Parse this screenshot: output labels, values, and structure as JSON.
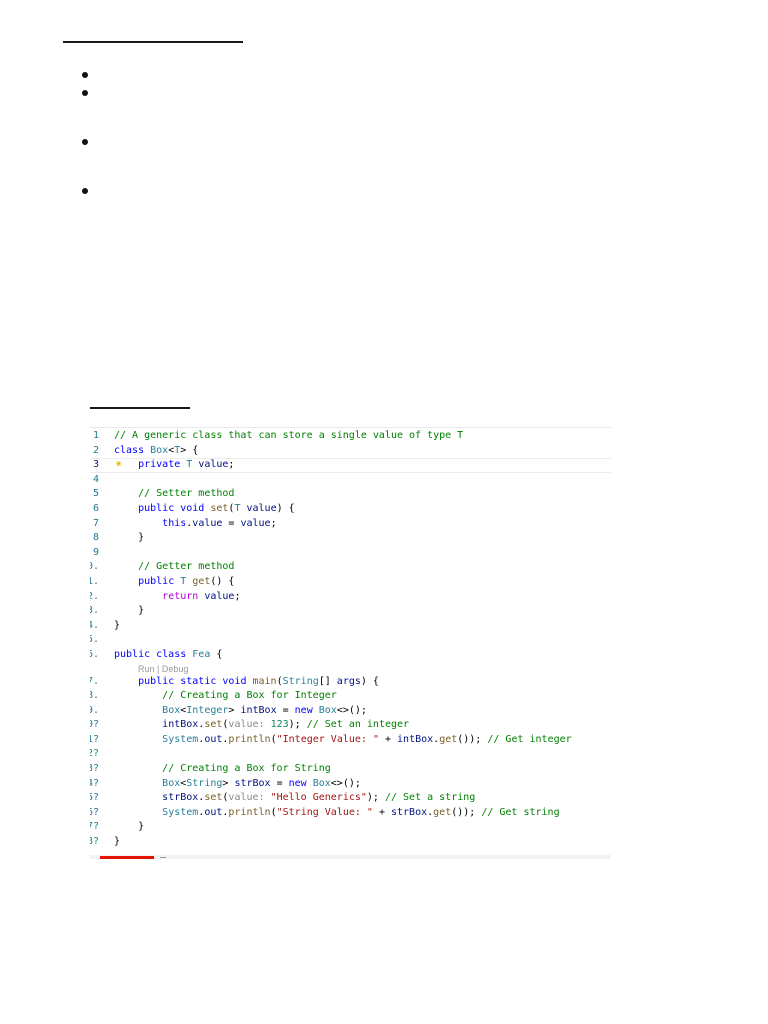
{
  "bullets": [
    "",
    "",
    "",
    ""
  ],
  "editor": {
    "breadcrumb": "",
    "lines": [
      {
        "no": "1",
        "tokens": [
          {
            "c": "cm",
            "t": "// A generic class that can store a single value of type T"
          }
        ]
      },
      {
        "no": "2",
        "tokens": [
          {
            "c": "kw",
            "t": "class "
          },
          {
            "c": "ty",
            "t": "Box"
          },
          {
            "c": "pl",
            "t": "<"
          },
          {
            "c": "ty",
            "t": "T"
          },
          {
            "c": "pl",
            "t": "> {"
          }
        ]
      },
      {
        "no": "3",
        "active": true,
        "bulb": true,
        "tokens": [
          {
            "c": "pl",
            "t": "    "
          },
          {
            "c": "kw",
            "t": "private "
          },
          {
            "c": "ty",
            "t": "T "
          },
          {
            "c": "vr",
            "t": "value"
          },
          {
            "c": "pl",
            "t": ";"
          }
        ]
      },
      {
        "no": "4",
        "tokens": []
      },
      {
        "no": "5",
        "tokens": [
          {
            "c": "pl",
            "t": "    "
          },
          {
            "c": "cm",
            "t": "// Setter method"
          }
        ]
      },
      {
        "no": "6",
        "tokens": [
          {
            "c": "pl",
            "t": "    "
          },
          {
            "c": "kw",
            "t": "public void "
          },
          {
            "c": "fn",
            "t": "set"
          },
          {
            "c": "pl",
            "t": "("
          },
          {
            "c": "ty",
            "t": "T "
          },
          {
            "c": "vr",
            "t": "value"
          },
          {
            "c": "pl",
            "t": ") {"
          }
        ]
      },
      {
        "no": "7",
        "tokens": [
          {
            "c": "pl",
            "t": "        "
          },
          {
            "c": "kw",
            "t": "this"
          },
          {
            "c": "pl",
            "t": "."
          },
          {
            "c": "vr",
            "t": "value"
          },
          {
            "c": "pl",
            "t": " = "
          },
          {
            "c": "vr",
            "t": "value"
          },
          {
            "c": "pl",
            "t": ";"
          }
        ]
      },
      {
        "no": "8",
        "tokens": [
          {
            "c": "pl",
            "t": "    }"
          }
        ]
      },
      {
        "no": "9",
        "tokens": []
      },
      {
        "no": ".0",
        "tokens": [
          {
            "c": "pl",
            "t": "    "
          },
          {
            "c": "cm",
            "t": "// Getter method"
          }
        ]
      },
      {
        "no": ".1",
        "tokens": [
          {
            "c": "pl",
            "t": "    "
          },
          {
            "c": "kw",
            "t": "public "
          },
          {
            "c": "ty",
            "t": "T "
          },
          {
            "c": "fn",
            "t": "get"
          },
          {
            "c": "pl",
            "t": "() {"
          }
        ]
      },
      {
        "no": ".2",
        "tokens": [
          {
            "c": "pl",
            "t": "        "
          },
          {
            "c": "kw2",
            "t": "return "
          },
          {
            "c": "vr",
            "t": "value"
          },
          {
            "c": "pl",
            "t": ";"
          }
        ]
      },
      {
        "no": ".3",
        "tokens": [
          {
            "c": "pl",
            "t": "    }"
          }
        ]
      },
      {
        "no": ".4",
        "tokens": [
          {
            "c": "pl",
            "t": "}"
          }
        ]
      },
      {
        "no": ".5",
        "tokens": []
      },
      {
        "no": ".6",
        "tokens": [
          {
            "c": "kw",
            "t": "public class "
          },
          {
            "c": "ty",
            "t": "Fea"
          },
          {
            "c": "pl",
            "t": " {"
          }
        ]
      },
      {
        "lens": "Run | Debug"
      },
      {
        "no": ".7",
        "tokens": [
          {
            "c": "pl",
            "t": "    "
          },
          {
            "c": "kw",
            "t": "public static void "
          },
          {
            "c": "fn",
            "t": "main"
          },
          {
            "c": "pl",
            "t": "("
          },
          {
            "c": "ty",
            "t": "String"
          },
          {
            "c": "pl",
            "t": "[] "
          },
          {
            "c": "vr",
            "t": "args"
          },
          {
            "c": "pl",
            "t": ") {"
          }
        ]
      },
      {
        "no": ".8",
        "tokens": [
          {
            "c": "pl",
            "t": "        "
          },
          {
            "c": "cm",
            "t": "// Creating a Box for Integer"
          }
        ]
      },
      {
        "no": ".9",
        "tokens": [
          {
            "c": "pl",
            "t": "        "
          },
          {
            "c": "ty",
            "t": "Box"
          },
          {
            "c": "pl",
            "t": "<"
          },
          {
            "c": "ty",
            "t": "Integer"
          },
          {
            "c": "pl",
            "t": "> "
          },
          {
            "c": "vr",
            "t": "intBox"
          },
          {
            "c": "pl",
            "t": " = "
          },
          {
            "c": "kw",
            "t": "new "
          },
          {
            "c": "ty",
            "t": "Box"
          },
          {
            "c": "pl",
            "t": "<>();"
          }
        ]
      },
      {
        "no": "?0",
        "tokens": [
          {
            "c": "pl",
            "t": "        "
          },
          {
            "c": "vr",
            "t": "intBox"
          },
          {
            "c": "pl",
            "t": "."
          },
          {
            "c": "fn",
            "t": "set"
          },
          {
            "c": "pl",
            "t": "("
          },
          {
            "c": "hn",
            "t": "value: "
          },
          {
            "c": "nm",
            "t": "123"
          },
          {
            "c": "pl",
            "t": "); "
          },
          {
            "c": "cm",
            "t": "// Set an integer"
          }
        ]
      },
      {
        "no": "?1",
        "tokens": [
          {
            "c": "pl",
            "t": "        "
          },
          {
            "c": "ty",
            "t": "System"
          },
          {
            "c": "pl",
            "t": "."
          },
          {
            "c": "vr",
            "t": "out"
          },
          {
            "c": "pl",
            "t": "."
          },
          {
            "c": "fn",
            "t": "println"
          },
          {
            "c": "pl",
            "t": "("
          },
          {
            "c": "st",
            "t": "\"Integer Value: \""
          },
          {
            "c": "pl",
            "t": " + "
          },
          {
            "c": "vr",
            "t": "intBox"
          },
          {
            "c": "pl",
            "t": "."
          },
          {
            "c": "fn",
            "t": "get"
          },
          {
            "c": "pl",
            "t": "()); "
          },
          {
            "c": "cm",
            "t": "// Get integer"
          }
        ]
      },
      {
        "no": "?2",
        "tokens": []
      },
      {
        "no": "?3",
        "tokens": [
          {
            "c": "pl",
            "t": "        "
          },
          {
            "c": "cm",
            "t": "// Creating a Box for String"
          }
        ]
      },
      {
        "no": "?4",
        "tokens": [
          {
            "c": "pl",
            "t": "        "
          },
          {
            "c": "ty",
            "t": "Box"
          },
          {
            "c": "pl",
            "t": "<"
          },
          {
            "c": "ty",
            "t": "String"
          },
          {
            "c": "pl",
            "t": "> "
          },
          {
            "c": "vr",
            "t": "strBox"
          },
          {
            "c": "pl",
            "t": " = "
          },
          {
            "c": "kw",
            "t": "new "
          },
          {
            "c": "ty",
            "t": "Box"
          },
          {
            "c": "pl",
            "t": "<>();"
          }
        ]
      },
      {
        "no": "?5",
        "tokens": [
          {
            "c": "pl",
            "t": "        "
          },
          {
            "c": "vr",
            "t": "strBox"
          },
          {
            "c": "pl",
            "t": "."
          },
          {
            "c": "fn",
            "t": "set"
          },
          {
            "c": "pl",
            "t": "("
          },
          {
            "c": "hn",
            "t": "value: "
          },
          {
            "c": "st",
            "t": "\"Hello Generics\""
          },
          {
            "c": "pl",
            "t": "); "
          },
          {
            "c": "cm",
            "t": "// Set a string"
          }
        ]
      },
      {
        "no": "?6",
        "tokens": [
          {
            "c": "pl",
            "t": "        "
          },
          {
            "c": "ty",
            "t": "System"
          },
          {
            "c": "pl",
            "t": "."
          },
          {
            "c": "vr",
            "t": "out"
          },
          {
            "c": "pl",
            "t": "."
          },
          {
            "c": "fn",
            "t": "println"
          },
          {
            "c": "pl",
            "t": "("
          },
          {
            "c": "st",
            "t": "\"String Value: \""
          },
          {
            "c": "pl",
            "t": " + "
          },
          {
            "c": "vr",
            "t": "strBox"
          },
          {
            "c": "pl",
            "t": "."
          },
          {
            "c": "fn",
            "t": "get"
          },
          {
            "c": "pl",
            "t": "()); "
          },
          {
            "c": "cm",
            "t": "// Get string"
          }
        ]
      },
      {
        "no": "?7",
        "tokens": [
          {
            "c": "pl",
            "t": "    }"
          }
        ]
      },
      {
        "no": "?8",
        "tokens": [
          {
            "c": "pl",
            "t": "}"
          }
        ]
      }
    ]
  },
  "colors": {
    "keyword": "#0000ff",
    "control": "#af00db",
    "type": "#267f99",
    "comment": "#008000",
    "string": "#a31515",
    "number": "#098658",
    "function": "#795e26",
    "variable": "#001080",
    "hint": "#8a8a8a",
    "line_number": "#237893",
    "error_mark": "#e51400"
  },
  "icons": {
    "lightbulb": "lightbulb-icon"
  }
}
